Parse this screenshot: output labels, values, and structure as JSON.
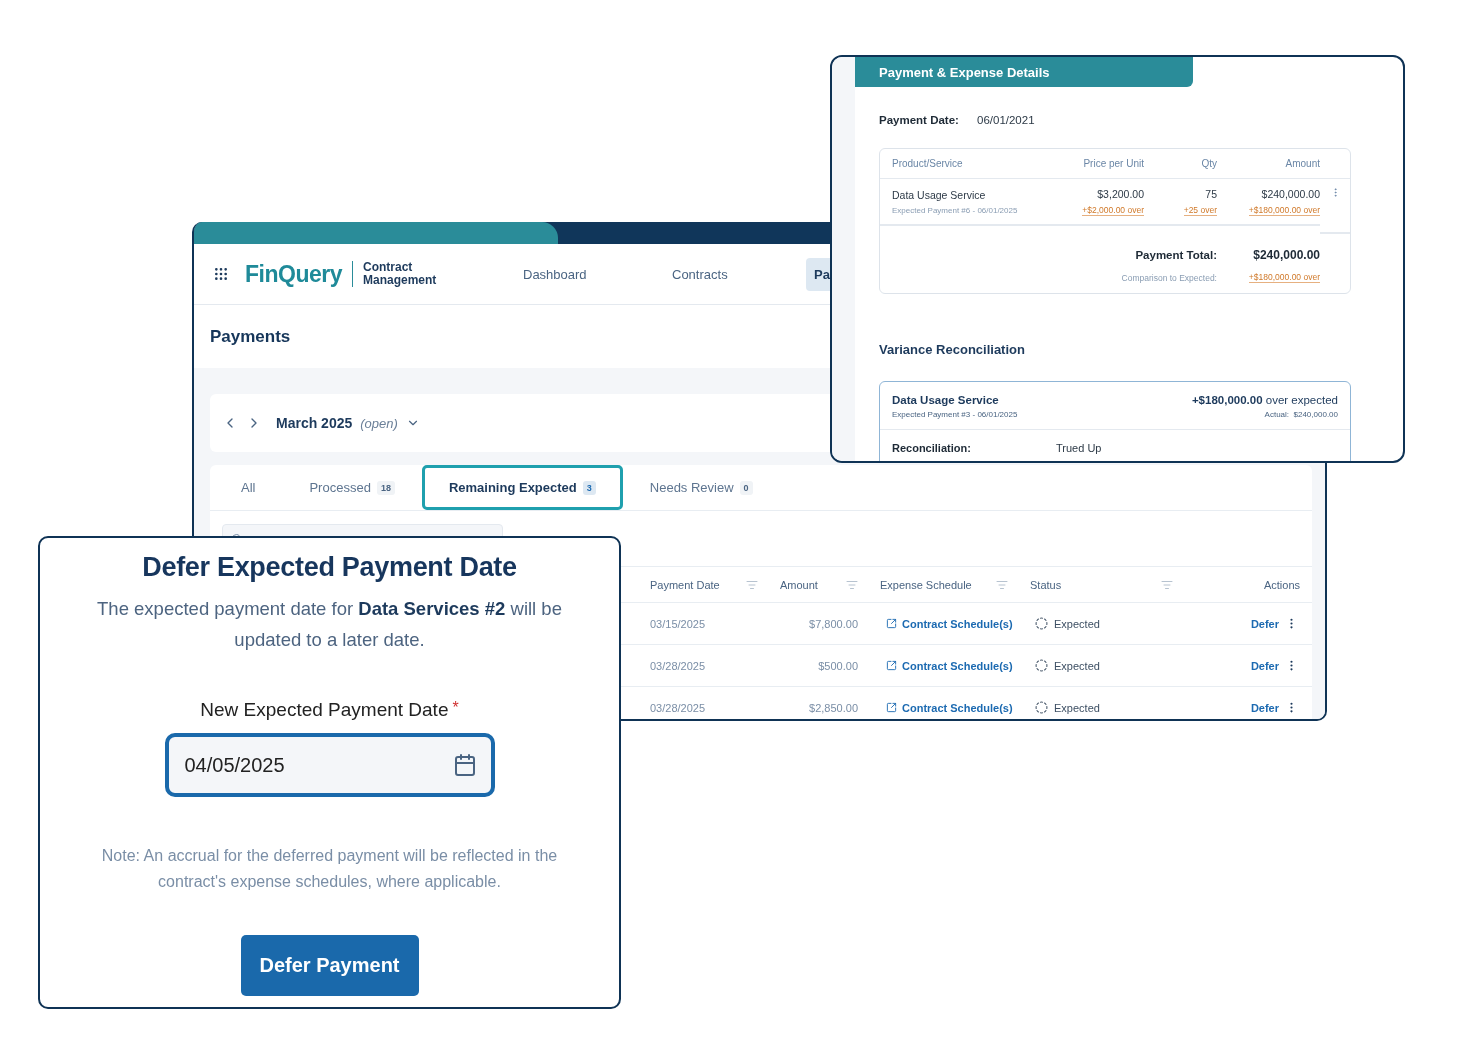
{
  "main_window": {
    "app": {
      "logo": "FinQuery",
      "product": "Contract Management"
    },
    "nav": [
      {
        "label": "Dashboard",
        "selected": false
      },
      {
        "label": "Contracts",
        "selected": false
      },
      {
        "label": "Pa",
        "selected": true
      }
    ],
    "page_title": "Payments",
    "period": {
      "label": "March 2025",
      "status": "(open)"
    },
    "tabs": [
      {
        "label": "All",
        "selected": false
      },
      {
        "label": "Processed",
        "count": "18",
        "selected": false
      },
      {
        "label": "Remaining Expected",
        "count": "3",
        "selected": true
      },
      {
        "label": "Needs Review",
        "count": "0",
        "selected": false
      }
    ],
    "table": {
      "columns": [
        {
          "label": "Payment Date",
          "filterable": true
        },
        {
          "label": "Amount",
          "filterable": true
        },
        {
          "label": "Expense Schedule",
          "filterable": true
        },
        {
          "label": "Status",
          "filterable": true
        },
        {
          "label": "Actions",
          "filterable": false
        }
      ],
      "rows": [
        {
          "payment_date": "03/15/2025",
          "amount": "$7,800.00",
          "expense_schedule": "Contract Schedule(s)",
          "status": "Expected",
          "action": "Defer"
        },
        {
          "payment_date": "03/28/2025",
          "amount": "$500.00",
          "expense_schedule": "Contract Schedule(s)",
          "status": "Expected",
          "action": "Defer"
        },
        {
          "payment_date": "03/28/2025",
          "amount": "$2,850.00",
          "expense_schedule": "Contract Schedule(s)",
          "status": "Expected",
          "action": "Defer"
        }
      ]
    }
  },
  "details_window": {
    "title": "Payment & Expense Details",
    "payment_date": {
      "label": "Payment Date:",
      "value": "06/01/2021"
    },
    "line_items": {
      "columns": [
        "Product/Service",
        "Price per Unit",
        "Qty",
        "Amount"
      ],
      "rows": [
        {
          "product": "Data Usage Service",
          "reference": "Expected Payment #6 - 06/01/2025",
          "price": "$3,200.00",
          "price_variance": "+$2,000.00 over",
          "qty": "75",
          "qty_variance": "+25 over",
          "amount": "$240,000.00",
          "amount_variance": "+$180,000.00 over"
        }
      ],
      "total": {
        "label": "Payment Total:",
        "value": "$240,000.00",
        "comparison_label": "Comparison to Expected:",
        "comparison_value": "+$180,000.00 over"
      }
    },
    "variance": {
      "heading": "Variance Reconciliation",
      "items": [
        {
          "name": "Data Usage Service",
          "reference": "Expected Payment #3 - 06/01/2025",
          "difference": "**+$180,000.00** over expected",
          "actual": "Actual:  $240,000.00",
          "reconciliation_label": "Reconciliation:",
          "reconciliation_value": "Trued Up"
        }
      ]
    }
  },
  "defer_dialog": {
    "title": "Defer Expected Payment Date",
    "message": "The expected payment date for **Data Services #2** will be updated to a later date.",
    "field": {
      "label": "New Expected Payment Date",
      "required": true,
      "required_mark": "*",
      "value": "04/05/2025"
    },
    "note": "Note: An accrual for the deferred payment will be reflected in the contract's expense schedules, where applicable.",
    "button": "Defer Payment"
  }
}
